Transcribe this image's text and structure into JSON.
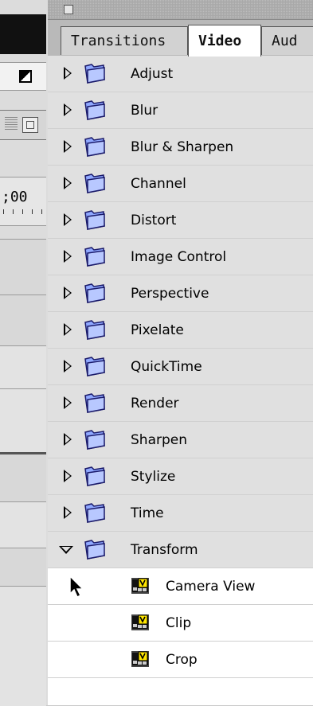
{
  "left_panel": {
    "timecode": ";00"
  },
  "palette": {
    "tabs": [
      {
        "label": "Transitions"
      },
      {
        "label": "Video"
      },
      {
        "label": "Aud"
      }
    ],
    "folders": [
      {
        "label": "Adjust",
        "icon": "folder-icon",
        "expanded": false
      },
      {
        "label": "Blur",
        "icon": "folder-icon",
        "expanded": false
      },
      {
        "label": "Blur & Sharpen",
        "icon": "folder-icon",
        "expanded": false
      },
      {
        "label": "Channel",
        "icon": "folder-icon",
        "expanded": false
      },
      {
        "label": "Distort",
        "icon": "folder-icon",
        "expanded": false
      },
      {
        "label": "Image Control",
        "icon": "folder-icon",
        "expanded": false
      },
      {
        "label": "Perspective",
        "icon": "folder-icon",
        "expanded": false
      },
      {
        "label": "Pixelate",
        "icon": "folder-icon",
        "expanded": false
      },
      {
        "label": "QuickTime",
        "icon": "folder-icon",
        "expanded": false
      },
      {
        "label": "Render",
        "icon": "folder-icon",
        "expanded": false
      },
      {
        "label": "Sharpen",
        "icon": "folder-icon",
        "expanded": false
      },
      {
        "label": "Stylize",
        "icon": "folder-icon",
        "expanded": false
      },
      {
        "label": "Time",
        "icon": "folder-icon",
        "expanded": false
      },
      {
        "label": "Transform",
        "icon": "folder-icon",
        "expanded": true
      }
    ],
    "transform_items": [
      {
        "label": "Camera View",
        "icon": "video-effect-icon"
      },
      {
        "label": "Clip",
        "icon": "video-effect-icon"
      },
      {
        "label": "Crop",
        "icon": "video-effect-icon"
      }
    ]
  }
}
